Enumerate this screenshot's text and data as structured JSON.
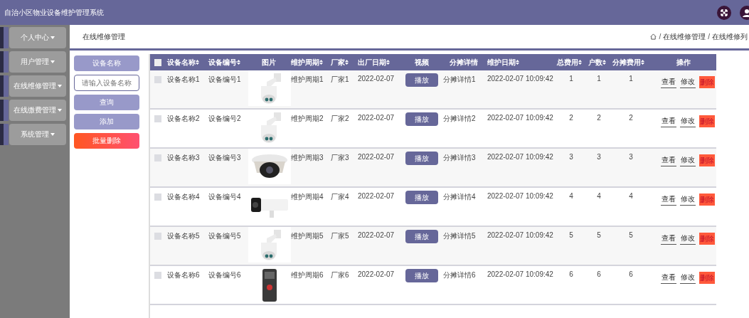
{
  "header": {
    "title": "自治小区物业设备维护管理系统"
  },
  "sidebar": {
    "items": [
      {
        "label": "个人中心"
      },
      {
        "label": "用户管理"
      },
      {
        "label": "在线维修管理"
      },
      {
        "label": "在线缴费管理"
      },
      {
        "label": "系统管理"
      }
    ]
  },
  "page_title": "在线维修管理",
  "breadcrumb": [
    {
      "separator": "/",
      "label": "在线维修管理"
    },
    {
      "separator": "/",
      "label": "在线维修列"
    }
  ],
  "search": {
    "label": "设备名称",
    "placeholder": "请输入设备名称",
    "buttons": [
      {
        "label": "查询",
        "kind": "primary"
      },
      {
        "label": "添加",
        "kind": "primary"
      },
      {
        "label": "批量删除",
        "kind": "danger"
      }
    ]
  },
  "table": {
    "select_all": {
      "checked": false
    },
    "columns": [
      {
        "label": "设备名称",
        "sortable": true
      },
      {
        "label": "设备编号",
        "sortable": true
      },
      {
        "label": "图片",
        "sortable": false
      },
      {
        "label": "维护周期",
        "sortable": true
      },
      {
        "label": "厂家",
        "sortable": true
      },
      {
        "label": "出厂日期",
        "sortable": true
      },
      {
        "label": "视频",
        "sortable": false
      },
      {
        "label": "分摊详情",
        "sortable": false
      },
      {
        "label": "维护日期",
        "sortable": true
      },
      {
        "label": "总费用",
        "sortable": true
      },
      {
        "label": "户数",
        "sortable": true
      },
      {
        "label": "分摊费用",
        "sortable": true
      },
      {
        "label": "操作",
        "sortable": false
      }
    ],
    "rows": [
      {
        "checked": false,
        "name": "设备名称1",
        "code": "设备编号1",
        "period": "维护周期1",
        "factory": "厂家1",
        "date": "2022-02-07",
        "video": "播放",
        "detail": "分摊详情1",
        "maint_date": "2022-02-07 10:09:42",
        "total": "1",
        "households": "1",
        "share": "1",
        "actions": [
          "查看",
          "修改",
          "删除"
        ]
      },
      {
        "checked": false,
        "name": "设备名称2",
        "code": "设备编号2",
        "period": "维护周期2",
        "factory": "厂家2",
        "date": "2022-02-07",
        "video": "播放",
        "detail": "分摊详情2",
        "maint_date": "2022-02-07 10:09:42",
        "total": "2",
        "households": "2",
        "share": "2",
        "actions": [
          "查看",
          "修改",
          "删除"
        ]
      },
      {
        "checked": false,
        "name": "设备名称3",
        "code": "设备编号3",
        "period": "维护周期3",
        "factory": "厂家3",
        "date": "2022-02-07",
        "video": "播放",
        "detail": "分摊详情3",
        "maint_date": "2022-02-07 10:09:42",
        "total": "3",
        "households": "3",
        "share": "3",
        "actions": [
          "查看",
          "修改",
          "删除"
        ]
      },
      {
        "checked": false,
        "name": "设备名称4",
        "code": "设备编号4",
        "period": "维护周期4",
        "factory": "厂家4",
        "date": "2022-02-07",
        "video": "播放",
        "detail": "分摊详情4",
        "maint_date": "2022-02-07 10:09:42",
        "total": "4",
        "households": "4",
        "share": "4",
        "actions": [
          "查看",
          "修改",
          "删除"
        ]
      },
      {
        "checked": false,
        "name": "设备名称5",
        "code": "设备编号5",
        "period": "维护周期5",
        "factory": "厂家5",
        "date": "2022-02-07",
        "video": "播放",
        "detail": "分摊详情5",
        "maint_date": "2022-02-07 10:09:42",
        "total": "5",
        "households": "5",
        "share": "5",
        "actions": [
          "查看",
          "修改",
          "删除"
        ]
      },
      {
        "checked": false,
        "name": "设备名称6",
        "code": "设备编号6",
        "period": "维护周期6",
        "factory": "厂家6",
        "date": "2022-02-07",
        "video": "播放",
        "detail": "分摊详情6",
        "maint_date": "2022-02-07 10:09:42",
        "total": "6",
        "households": "6",
        "share": "6",
        "actions": [
          "查看",
          "修改",
          "删除"
        ]
      }
    ]
  }
}
